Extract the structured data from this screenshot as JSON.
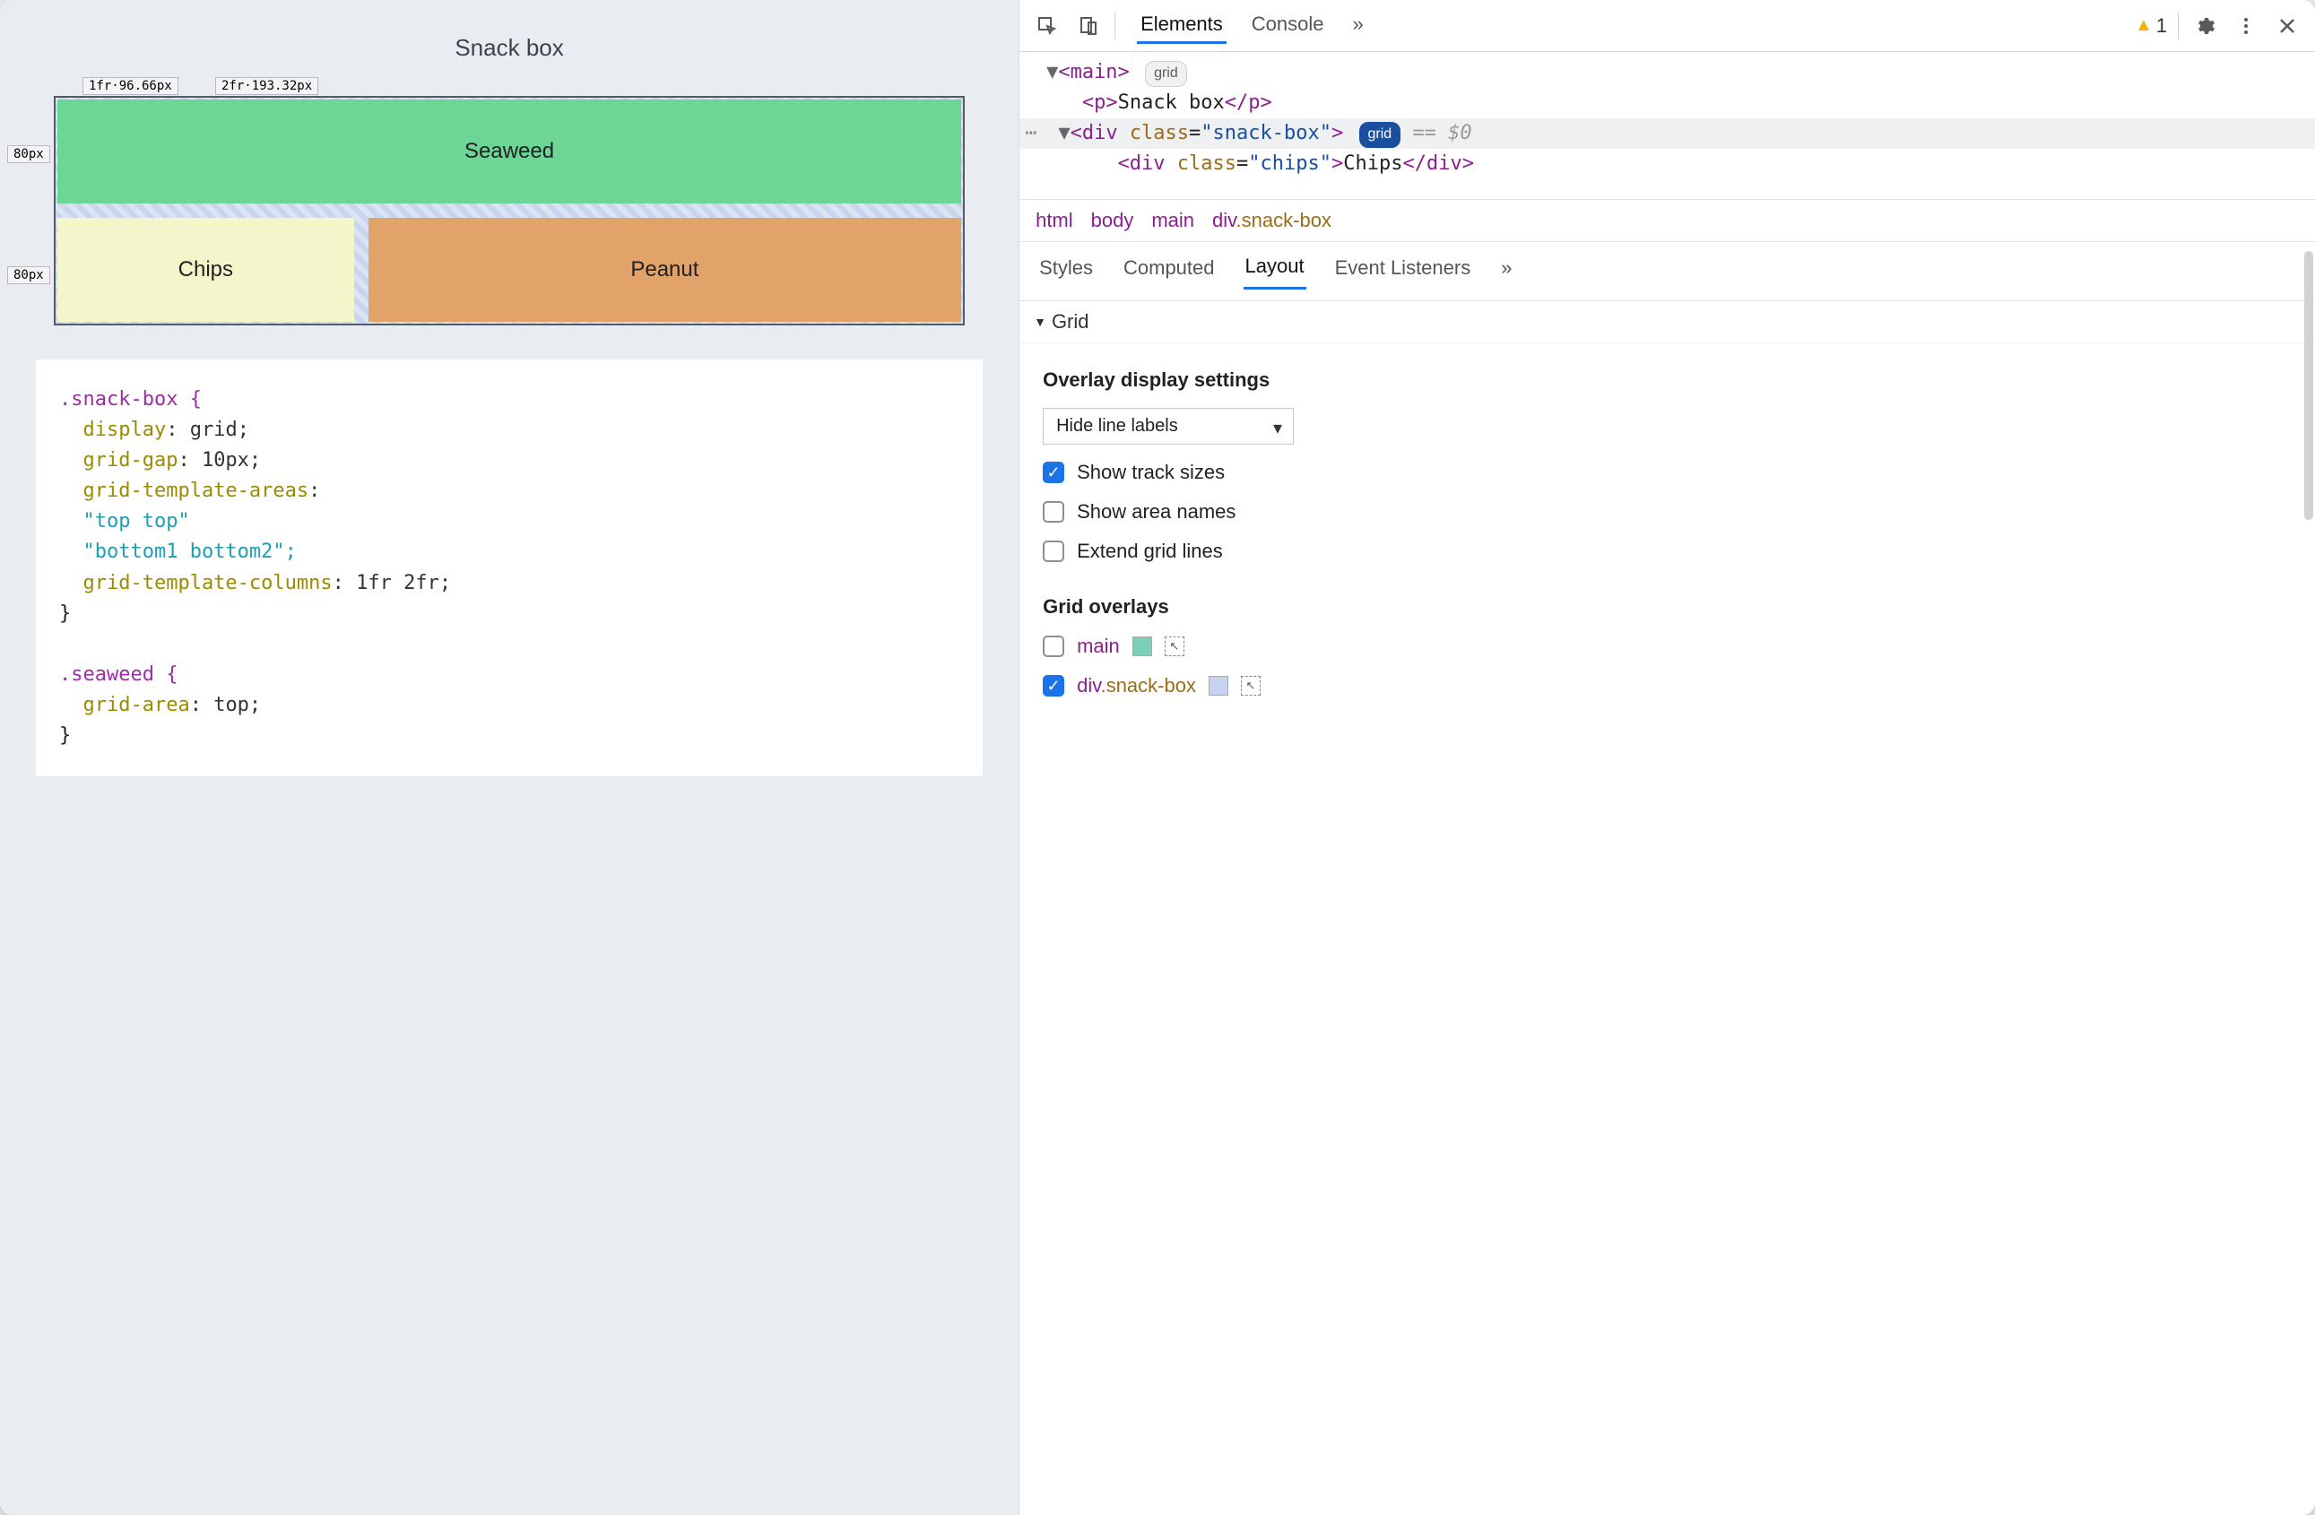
{
  "preview": {
    "title": "Snack box",
    "tracks": {
      "col1": "1fr·96.66px",
      "col2": "2fr·193.32px",
      "row1": "80px",
      "row2": "80px"
    },
    "cells": {
      "seaweed": "Seaweed",
      "chips": "Chips",
      "peanut": "Peanut"
    }
  },
  "css": {
    "l1": ".snack-box {",
    "l2a": "  display",
    "l2b": ": grid;",
    "l3a": "  grid-gap",
    "l3b": ": 10px;",
    "l4a": "  grid-template-areas",
    "l4b": ":",
    "l5": "  \"top top\"",
    "l6": "  \"bottom1 bottom2\";",
    "l7a": "  grid-template-columns",
    "l7b": ": 1fr 2fr;",
    "l8": "}",
    "l9": "",
    "l10": ".seaweed {",
    "l11a": "  grid-area",
    "l11b": ": top;",
    "l12": "}"
  },
  "devtools": {
    "tabs": {
      "elements": "Elements",
      "console": "Console",
      "more": "»"
    },
    "warn_count": "1",
    "tree": {
      "main_open": "<main>",
      "grid_badge": "grid",
      "p_open": "<p>",
      "p_text": "Snack box",
      "p_close": "</p>",
      "div_open_tag": "div",
      "div_class_attr": "class",
      "div_class_val": "\"snack-box\"",
      "eq_dollar0": "== $0",
      "chips_open_tag": "div",
      "chips_class_attr": "class",
      "chips_class_val": "\"chips\"",
      "chips_text": "Chips",
      "chips_close": "</div>"
    },
    "breadcrumbs": {
      "b0": "html",
      "b1": "body",
      "b2": "main",
      "b3": "div",
      "b3cls": ".snack-box"
    },
    "subtabs": {
      "styles": "Styles",
      "computed": "Computed",
      "layout": "Layout",
      "eventlisteners": "Event Listeners",
      "more": "»"
    },
    "grid_section": "Grid",
    "overlay_settings_heading": "Overlay display settings",
    "select_value": "Hide line labels",
    "cb_track_sizes": "Show track sizes",
    "cb_area_names": "Show area names",
    "cb_extend": "Extend grid lines",
    "grid_overlays_heading": "Grid overlays",
    "overlays": {
      "main_label": "main",
      "main_swatch": "#7ccfba",
      "sb_label": "div",
      "sb_cls": ".snack-box",
      "sb_swatch": "#c6d2f0"
    }
  }
}
